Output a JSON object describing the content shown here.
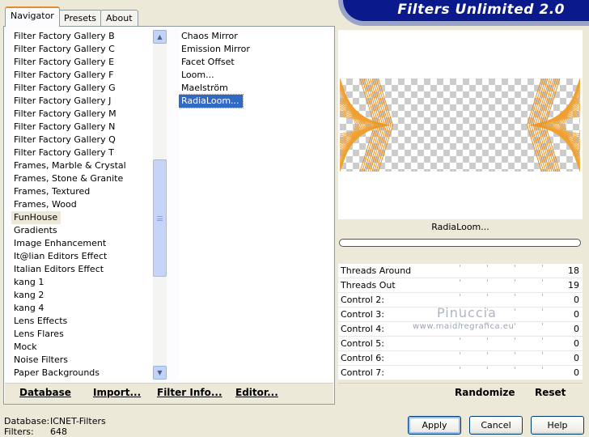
{
  "tabs": [
    {
      "label": "Navigator",
      "active": true
    },
    {
      "label": "Presets",
      "active": false
    },
    {
      "label": "About",
      "active": false
    }
  ],
  "app_title": "Filters Unlimited 2.0",
  "category_list": {
    "items": [
      "Filter Factory Gallery B",
      "Filter Factory Gallery C",
      "Filter Factory Gallery E",
      "Filter Factory Gallery F",
      "Filter Factory Gallery G",
      "Filter Factory Gallery J",
      "Filter Factory Gallery M",
      "Filter Factory Gallery N",
      "Filter Factory Gallery Q",
      "Filter Factory Gallery T",
      "Frames, Marble & Crystal",
      "Frames, Stone & Granite",
      "Frames, Textured",
      "Frames, Wood",
      "FunHouse",
      "Gradients",
      "Image Enhancement",
      "It@lian Editors Effect",
      "Italian Editors Effect",
      "kang 1",
      "kang 2",
      "kang 4",
      "Lens Effects",
      "Lens Flares",
      "Mock",
      "Noise Filters",
      "Paper Backgrounds"
    ],
    "selected": "FunHouse"
  },
  "filter_list": {
    "items": [
      "Chaos Mirror",
      "Emission Mirror",
      "Facet Offset",
      "Loom...",
      "Maelström",
      "RadiaLoom..."
    ],
    "selected": "RadiaLoom..."
  },
  "bottom_buttons": {
    "database": "Database",
    "import": "Import...",
    "filter_info": "Filter Info...",
    "editor": "Editor...",
    "randomize": "Randomize",
    "reset": "Reset"
  },
  "preview": {
    "filter_name": "RadiaLoom...",
    "accent_color": "#f0a030"
  },
  "controls": [
    {
      "label": "Threads Around",
      "value": "18"
    },
    {
      "label": "Threads Out",
      "value": "19"
    },
    {
      "label": "Control 2:",
      "value": "0"
    },
    {
      "label": "Control 3:",
      "value": "0"
    },
    {
      "label": "Control 4:",
      "value": "0"
    },
    {
      "label": "Control 5:",
      "value": "0"
    },
    {
      "label": "Control 6:",
      "value": "0"
    },
    {
      "label": "Control 7:",
      "value": "0"
    }
  ],
  "watermark": {
    "name": "Pinuccia",
    "url": "www.maidiregrafica.eu"
  },
  "footer": {
    "database_label": "Database:",
    "database_value": "ICNET-Filters",
    "filters_label": "Filters:",
    "filters_value": "648"
  },
  "dialog_buttons": {
    "apply": "Apply",
    "cancel": "Cancel",
    "help": "Help"
  }
}
